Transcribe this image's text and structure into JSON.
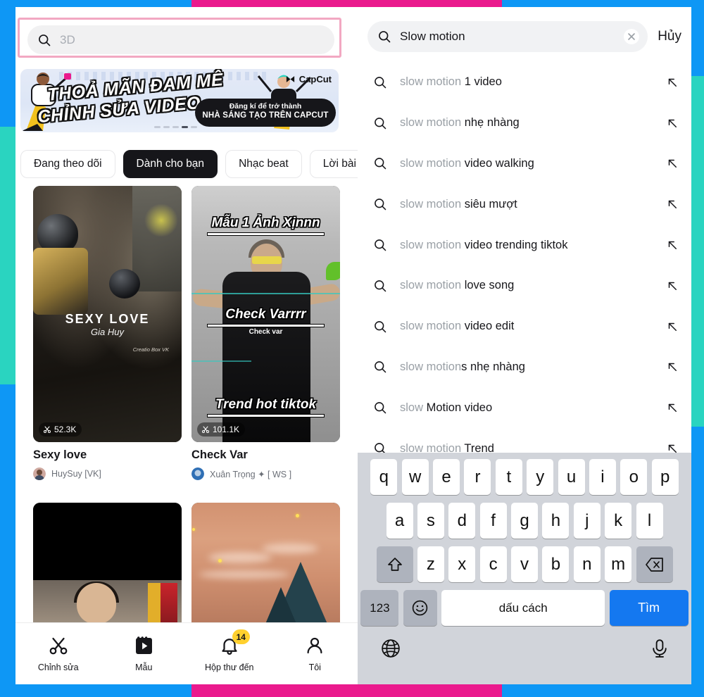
{
  "colors": {
    "brand_blue": "#0e97f5",
    "brand_pink": "#ea1a8d",
    "brand_teal": "#2ad4c0",
    "highlight_pink": "#f2a8c2",
    "key_blue": "#1478f0",
    "badge_yellow": "#ffd02e"
  },
  "left_panel": {
    "search": {
      "placeholder": "3D",
      "icon": "search-icon"
    },
    "banner": {
      "line1": "THOẢ MÃN ĐAM MÊ",
      "line2": "CHỈNH SỬA VIDEO",
      "cta_line1": "Đăng kí để trở thành",
      "cta_line2": "NHÀ SÁNG TẠO TRÊN CAPCUT",
      "brand": "CapCut"
    },
    "tabs": [
      {
        "label": "Đang theo dõi",
        "active": false
      },
      {
        "label": "Dành cho bạn",
        "active": true
      },
      {
        "label": "Nhạc beat",
        "active": false
      },
      {
        "label": "Lời bài hát",
        "active": false
      }
    ],
    "videos": [
      {
        "title": "Sexy love",
        "author": "HuySuy [VK]",
        "uses": "52.3K",
        "overlay_title": "SEXY LOVE",
        "overlay_sub": "Gia Huy",
        "overlay_credit": "Creatio Box VK"
      },
      {
        "title": "Check Var",
        "author": "Xuân Trọng ✦ [ WS ]",
        "uses": "101.1K",
        "overlay_top": "Mẫu 1 Ảnh Xịnnn",
        "overlay_mid": "Check Varrrr",
        "overlay_mid_sub": "Check var",
        "overlay_bottom": "Trend hot tiktok"
      }
    ],
    "bottom_nav": [
      {
        "label": "Chỉnh sửa",
        "icon": "scissors-icon",
        "badge": ""
      },
      {
        "label": "Mẫu",
        "icon": "template-icon",
        "badge": ""
      },
      {
        "label": "Hộp thư đến",
        "icon": "bell-icon",
        "badge": "14"
      },
      {
        "label": "Tôi",
        "icon": "person-icon",
        "badge": ""
      }
    ]
  },
  "right_panel": {
    "search": {
      "value": "Slow motion",
      "icon": "search-icon",
      "clear_icon": "close-icon",
      "cancel_label": "Hủy"
    },
    "suggestions": [
      {
        "prefix": "slow motion ",
        "bold": "1 video"
      },
      {
        "prefix": "slow motion ",
        "bold": "nhẹ nhàng"
      },
      {
        "prefix": "slow motion ",
        "bold": "video walking"
      },
      {
        "prefix": "slow motion ",
        "bold": "siêu mượt"
      },
      {
        "prefix": "slow motion ",
        "bold": "video trending tiktok"
      },
      {
        "prefix": "slow motion ",
        "bold": "love song"
      },
      {
        "prefix": "slow motion ",
        "bold": "video edit"
      },
      {
        "prefix": "slow motion",
        "bold": "s nhẹ nhàng"
      },
      {
        "prefix": "slow ",
        "bold": "Motion video"
      },
      {
        "prefix": "slow motion ",
        "bold": "Trend"
      }
    ],
    "keyboard": {
      "row1": [
        "q",
        "w",
        "e",
        "r",
        "t",
        "y",
        "u",
        "i",
        "o",
        "p"
      ],
      "row2": [
        "a",
        "s",
        "d",
        "f",
        "g",
        "h",
        "j",
        "k",
        "l"
      ],
      "row3": [
        "z",
        "x",
        "c",
        "v",
        "b",
        "n",
        "m"
      ],
      "shift_icon": "shift-icon",
      "backspace_icon": "backspace-icon",
      "numeric_label": "123",
      "emoji_icon": "emoji-icon",
      "space_label": "dấu cách",
      "go_label": "Tìm",
      "globe_icon": "globe-icon",
      "mic_icon": "microphone-icon"
    }
  }
}
